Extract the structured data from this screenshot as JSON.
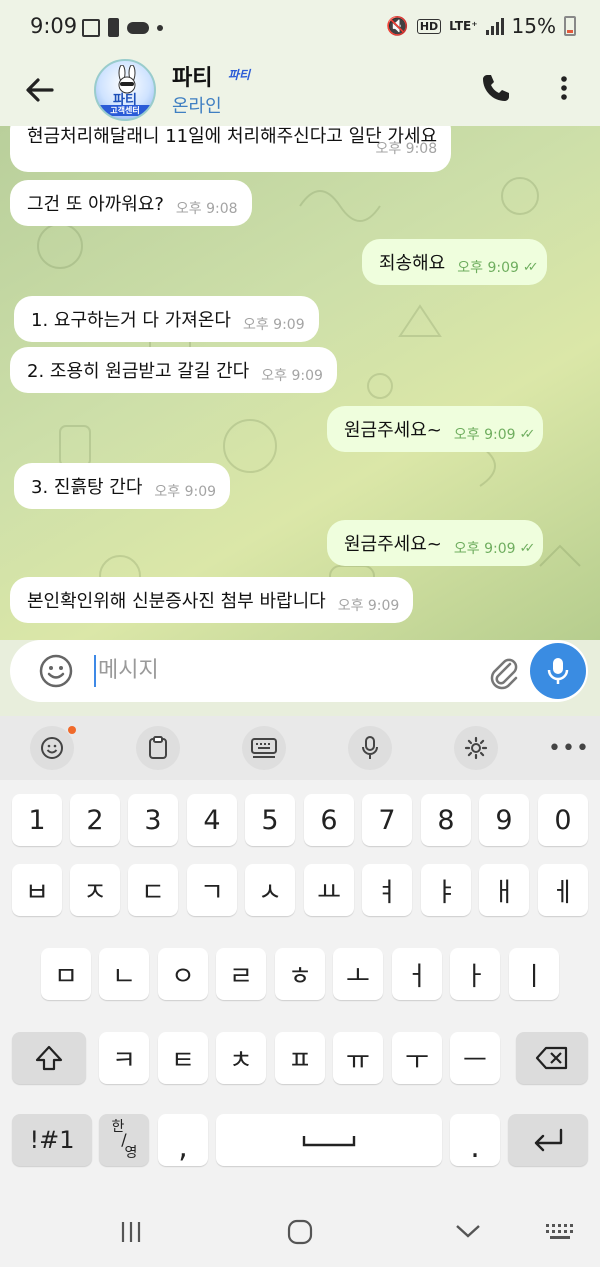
{
  "status_bar": {
    "time": "9:09",
    "hd": "HD",
    "lte": "LTE⁺",
    "battery": "15%"
  },
  "header": {
    "title": "파티",
    "title_badge": "파티",
    "avatar_text": "파티",
    "avatar_sub": "고객센터",
    "status": "온라인"
  },
  "messages": [
    {
      "dir": "in",
      "text": "현금처리해달래니 11일에 처리해주신다고 일단 가세요",
      "time": "오후 9:08"
    },
    {
      "dir": "in",
      "text": "그건 또 아까워요?",
      "time": "오후 9:08"
    },
    {
      "dir": "out",
      "text": "죄송해요",
      "time": "오후 9:09",
      "read": "✓✓"
    },
    {
      "dir": "in",
      "text": "1. 요구하는거 다 가져온다",
      "time": "오후 9:09"
    },
    {
      "dir": "in",
      "text": "2. 조용히 원금받고 갈길 간다",
      "time": "오후 9:09"
    },
    {
      "dir": "out",
      "text": "원금주세요~",
      "time": "오후 9:09",
      "read": "✓✓"
    },
    {
      "dir": "in",
      "text": "3. 진흙탕 간다",
      "time": "오후 9:09"
    },
    {
      "dir": "out",
      "text": "원금주세요~",
      "time": "오후 9:09",
      "read": "✓✓"
    },
    {
      "dir": "in",
      "text": "본인확인위해 신분증사진 첨부 바랍니다",
      "time": "오후 9:09"
    }
  ],
  "composer": {
    "placeholder": "메시지"
  },
  "keyboard": {
    "toolbar_icons": [
      "emoji-icon",
      "clipboard-icon",
      "keyboard-icon",
      "mic-icon",
      "settings-icon",
      "more-icon"
    ],
    "row_numbers": [
      "1",
      "2",
      "3",
      "4",
      "5",
      "6",
      "7",
      "8",
      "9",
      "0"
    ],
    "row_1": [
      "ㅂ",
      "ㅈ",
      "ㄷ",
      "ㄱ",
      "ㅅ",
      "ㅛ",
      "ㅕ",
      "ㅑ",
      "ㅐ",
      "ㅔ"
    ],
    "row_2": [
      "ㅁ",
      "ㄴ",
      "ㅇ",
      "ㄹ",
      "ㅎ",
      "ㅗ",
      "ㅓ",
      "ㅏ",
      "ㅣ"
    ],
    "row_3": [
      "ㅋ",
      "ㅌ",
      "ㅊ",
      "ㅍ",
      "ㅠ",
      "ㅜ",
      "ㅡ"
    ],
    "symbols_label": "!#1",
    "lang_top": "한",
    "lang_bottom": "영",
    "comma": ",",
    "period": "."
  },
  "colors": {
    "accent": "#3a8ce2",
    "outgoing_bubble": "#effedd",
    "incoming_bubble": "#ffffff",
    "online_text": "#3f7fc2",
    "read_ticks": "#6fae5f"
  }
}
